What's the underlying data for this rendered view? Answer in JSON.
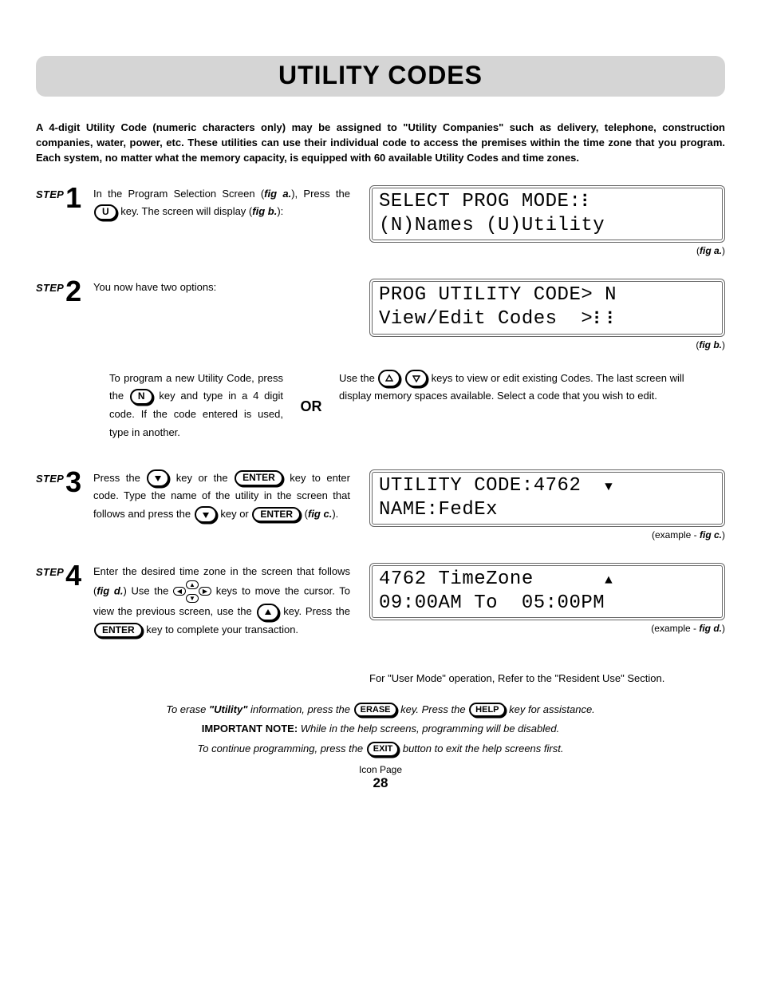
{
  "title": "UTILITY CODES",
  "intro": "A 4-digit Utility Code (numeric characters only) may be assigned to \"Utility Companies\" such as delivery, telephone, construction companies, water, power, etc. These utilities can use their individual code to access the premises within the time zone that you program. Each system, no matter what the memory capacity, is equipped with 60 available Utility Codes and time zones.",
  "step_word": "STEP",
  "steps": {
    "s1": {
      "num": "1",
      "t1": "In the Program Selection Screen (",
      "figA": "fig a.",
      "t2": "), Press the ",
      "keyU": "U",
      "t3": " key.  The screen will display (",
      "figB": "fig b.",
      "t4": "):"
    },
    "s2": {
      "num": "2",
      "t1": "You now have two options:"
    },
    "option": {
      "left1": "To program a new Utility Code, press the ",
      "keyN": "N",
      "left2": " key and type in a 4 digit code. If the code entered is used, type in another.",
      "or": "OR",
      "right1": "Use the ",
      "right2": " keys to view or edit existing Codes. The last screen will display memory spaces available. Select a code that you wish to edit."
    },
    "s3": {
      "num": "3",
      "t1": "Press the ",
      "t2": " key or the ",
      "enter": "ENTER",
      "t3": " key to enter code. Type the name of the utility in the screen that follows and press the ",
      "t4": " key or ",
      "t5": " (",
      "figC": "fig c.",
      "t6": ")."
    },
    "s4": {
      "num": "4",
      "t1": "Enter the desired time zone in the screen that follows (",
      "figD": "fig d.",
      "t2": ") Use the ",
      "t3": " keys to move the cursor. To view the previous screen, use the ",
      "t4": " key.  Press the ",
      "t5": " key to complete your transaction."
    }
  },
  "lcd": {
    "a1": "SELECT PROG MODE:",
    "a2": "(N)Names (U)Utility",
    "b1": "PROG UTILITY CODE> N",
    "b2": "View/Edit Codes  >",
    "c1": "UTILITY CODE:4762",
    "c2": "NAME:FedEx",
    "d1": "4762 TimeZone",
    "d2": "09:00AM To  05:00PM"
  },
  "chart_data": {
    "type": "table",
    "title": "LCD screen examples",
    "rows": [
      {
        "fig": "a",
        "line1": "SELECT PROG MODE:",
        "line2": "(N)Names (U)Utility"
      },
      {
        "fig": "b",
        "line1": "PROG UTILITY CODE> N",
        "line2": "View/Edit Codes  >"
      },
      {
        "fig": "c",
        "line1": "UTILITY CODE:4762",
        "line2": "NAME:FedEx"
      },
      {
        "fig": "d",
        "line1": "4762 TimeZone",
        "line2": "09:00AM To  05:00PM"
      }
    ]
  },
  "caps": {
    "a": "fig a.",
    "b": "fig b.",
    "c": "fig c.",
    "d": "fig d.",
    "example": "example - "
  },
  "usermode": "For \"User Mode\" operation, Refer to the \"Resident Use\" Section.",
  "foot": {
    "l1a": "To erase ",
    "l1b": "\"Utility\"",
    "l1c": " information, press the ",
    "erase": "ERASE",
    "l1d": " key. Press the ",
    "help": "HELP",
    "l1e": " key for assistance.",
    "l2a": "IMPORTANT NOTE:",
    "l2b": " While in the help screens, programming will be disabled.",
    "l3a": "To continue programming, press the ",
    "exit": "EXIT",
    "l3b": " button to exit the help screens first."
  },
  "iconpage": "Icon Page",
  "page": "28"
}
